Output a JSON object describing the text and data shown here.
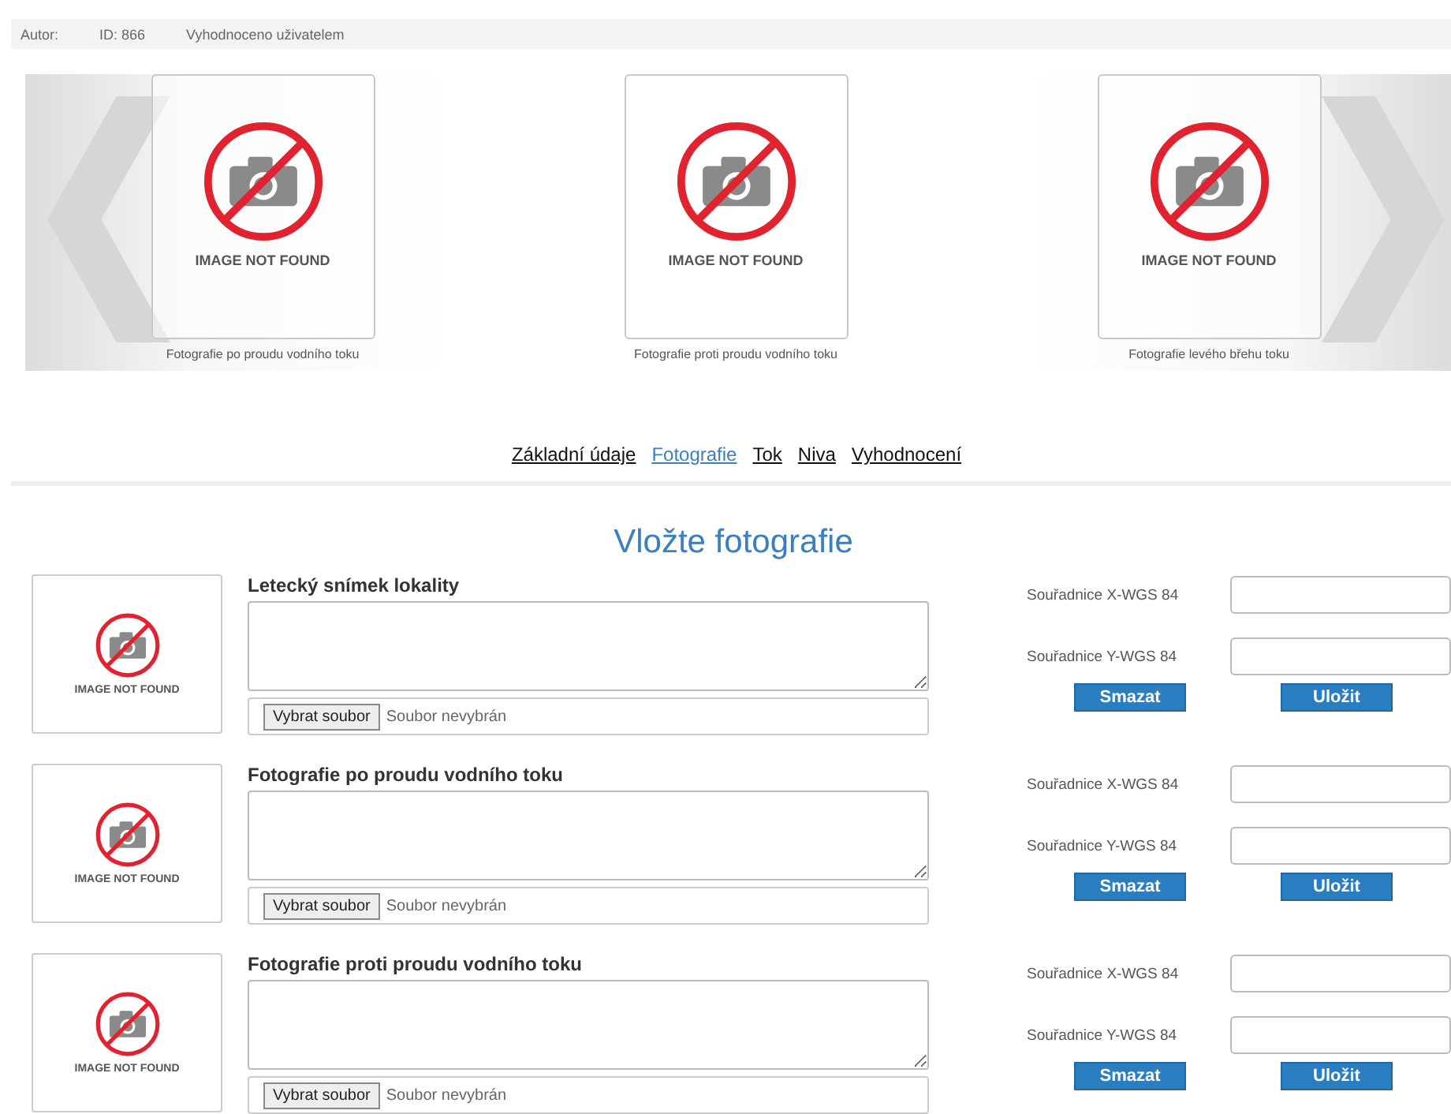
{
  "header": {
    "items": [
      "Autor:",
      "ID: 866",
      "Vyhodnoceno uživatelem"
    ]
  },
  "carousel": {
    "slides": [
      {
        "placeholder": "IMAGE NOT FOUND",
        "caption": "Fotografie po proudu vodního toku"
      },
      {
        "placeholder": "IMAGE NOT FOUND",
        "caption": "Fotografie proti proudu vodního toku"
      },
      {
        "placeholder": "IMAGE NOT FOUND",
        "caption": "Fotografie levého břehu toku"
      }
    ]
  },
  "nav": [
    {
      "label": "Základní údaje",
      "selected": false
    },
    {
      "label": "Fotografie",
      "selected": true
    },
    {
      "label": "Tok",
      "selected": false
    },
    {
      "label": "Niva",
      "selected": false
    },
    {
      "label": "Vyhodnocení",
      "selected": false
    }
  ],
  "section": {
    "title": "Vložte fotografie",
    "uploads": [
      {
        "placeholder": "IMAGE NOT FOUND",
        "label": "Letecký snímek lokality",
        "file_button": "Vybrat soubor",
        "file_status": "Soubor nevybrán",
        "coord_x_label": "Souřadnice X-WGS 84",
        "coord_y_label": "Souřadnice Y-WGS 84",
        "delete_button": "Smazat",
        "save_button": "Uložit"
      },
      {
        "placeholder": "IMAGE NOT FOUND",
        "label": "Fotografie po proudu vodního toku",
        "file_button": "Vybrat soubor",
        "file_status": "Soubor nevybrán",
        "coord_x_label": "Souřadnice X-WGS 84",
        "coord_y_label": "Souřadnice Y-WGS 84",
        "delete_button": "Smazat",
        "save_button": "Uložit"
      },
      {
        "placeholder": "IMAGE NOT FOUND",
        "label": "Fotografie proti proudu vodního toku",
        "file_button": "Vybrat soubor",
        "file_status": "Soubor nevybrán",
        "coord_x_label": "Souřadnice X-WGS 84",
        "coord_y_label": "Souřadnice Y-WGS 84",
        "delete_button": "Smazat",
        "save_button": "Uložit"
      }
    ]
  }
}
